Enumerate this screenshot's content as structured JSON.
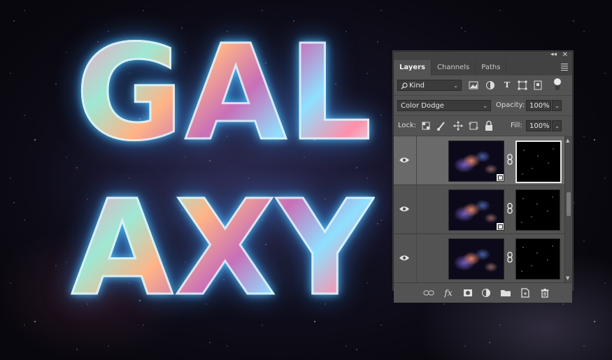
{
  "artwork": {
    "line1": "GAL",
    "line2": "AXY"
  },
  "panel": {
    "tabs": [
      {
        "label": "Layers",
        "active": true
      },
      {
        "label": "Channels",
        "active": false
      },
      {
        "label": "Paths",
        "active": false
      }
    ],
    "filter": {
      "kind_label": "Kind"
    },
    "blend_mode": "Color Dodge",
    "opacity_label": "Opacity:",
    "opacity_value": "100%",
    "lock_label": "Lock:",
    "fill_label": "Fill:",
    "fill_value": "100%"
  },
  "colors": {
    "panel_bg": "#535353",
    "panel_header": "#424242",
    "selected_layer": "#6a6a6a",
    "glow": "#50c8ff"
  }
}
